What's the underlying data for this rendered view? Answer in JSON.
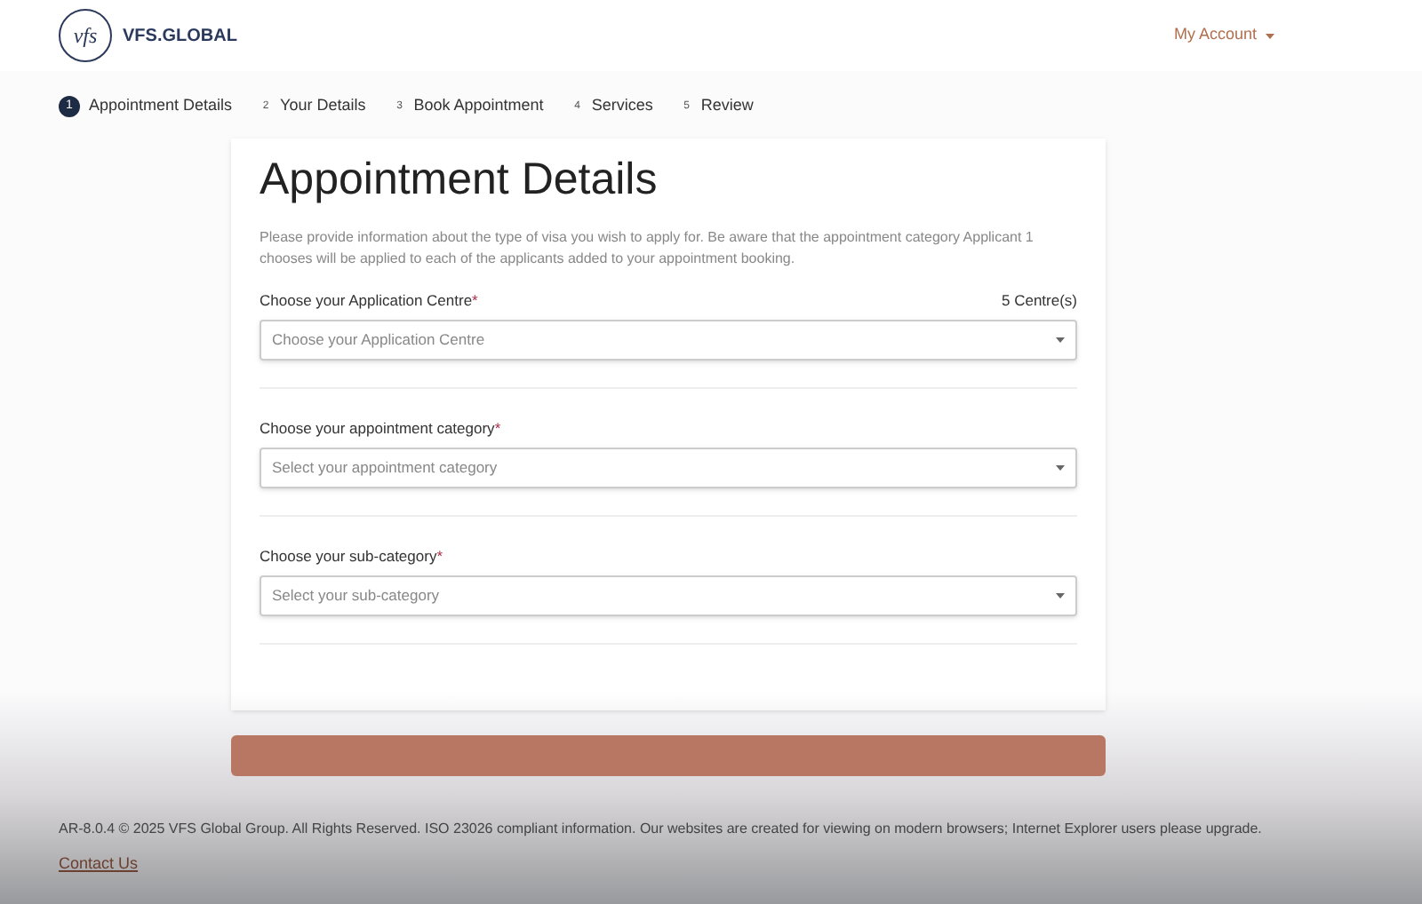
{
  "header": {
    "logo_mark": "vfs",
    "logo_text": "VFS.GLOBAL",
    "account_menu": "My Account"
  },
  "steps": [
    {
      "number": "1",
      "label": "Appointment Details",
      "selected": true
    },
    {
      "number": "2",
      "label": "Your Details",
      "selected": false
    },
    {
      "number": "3",
      "label": "Book Appointment",
      "selected": false
    },
    {
      "number": "4",
      "label": "Services",
      "selected": false
    },
    {
      "number": "5",
      "label": "Review",
      "selected": false
    }
  ],
  "form": {
    "title": "Appointment Details",
    "intro": "Please provide information about the type of visa you wish to apply for. Be aware that the appointment category Applicant 1 chooses will be applied to each of the applicants added to your appointment booking.",
    "fields": [
      {
        "label": "Choose your Application Centre",
        "required_mark": "*",
        "count": "5 Centre(s)",
        "placeholder": "Choose your Application Centre"
      },
      {
        "label": "Choose your appointment category",
        "required_mark": "*",
        "placeholder": "Select your appointment category"
      },
      {
        "label": "Choose your sub-category",
        "required_mark": "*",
        "placeholder": "Select your sub-category"
      }
    ]
  },
  "footer": {
    "text": "AR-8.0.4 © 2025 VFS Global Group. All Rights Reserved. ISO 23026 compliant information. Our websites are created for viewing on modern browsers; Internet Explorer users please upgrade.",
    "link": "Contact Us"
  }
}
